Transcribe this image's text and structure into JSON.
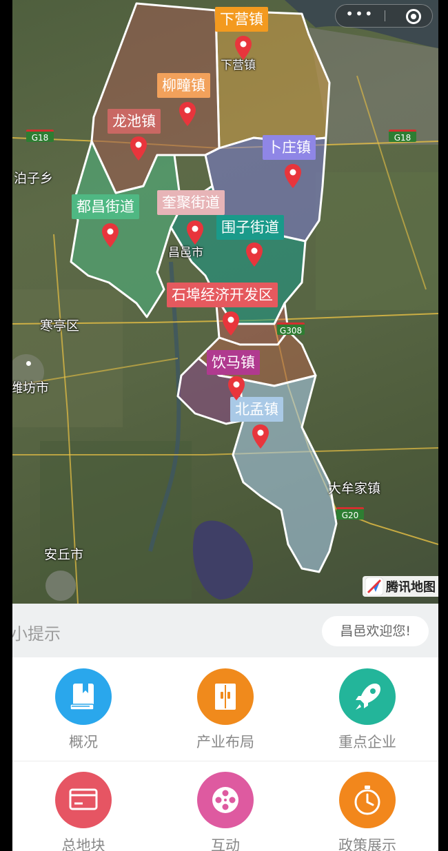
{
  "miniprogram": {
    "more_label": "•••"
  },
  "map": {
    "places": [
      {
        "label": "泊子乡"
      },
      {
        "label": "寒亭区"
      },
      {
        "label": "潍坊市"
      },
      {
        "label": "安丘市"
      },
      {
        "label": "大牟家镇"
      },
      {
        "label": "昌邑市"
      },
      {
        "label": "下营镇"
      }
    ],
    "roads": [
      "G18",
      "G18",
      "G308",
      "G20"
    ],
    "towns": [
      {
        "label": "下营镇",
        "color": "#f39a1f"
      },
      {
        "label": "柳疃镇",
        "color": "#f2a15b"
      },
      {
        "label": "龙池镇",
        "color": "#c96863"
      },
      {
        "label": "卜庄镇",
        "color": "#8f86e6"
      },
      {
        "label": "都昌街道",
        "color": "#4fb883"
      },
      {
        "label": "奎聚街道",
        "color": "#e7b4b7"
      },
      {
        "label": "围子街道",
        "color": "#1a9a8a"
      },
      {
        "label": "石埠经济开发区",
        "color": "#e5595e"
      },
      {
        "label": "饮马镇",
        "color": "#b03a8f"
      },
      {
        "label": "北孟镇",
        "color": "#a9c9e6"
      }
    ],
    "provider": "腾讯地图"
  },
  "tips": {
    "title": "小提示",
    "welcome": "昌邑欢迎您!"
  },
  "menu": [
    {
      "label": "概况",
      "icon": "book-icon",
      "color": "#2aa7ec"
    },
    {
      "label": "产业布局",
      "icon": "door-icon",
      "color": "#f08a1c"
    },
    {
      "label": "重点企业",
      "icon": "rocket-icon",
      "color": "#23b59a"
    },
    {
      "label": "总地块",
      "icon": "card-icon",
      "color": "#e65563"
    },
    {
      "label": "互动",
      "icon": "film-reel-icon",
      "color": "#de5aa0"
    },
    {
      "label": "政策展示",
      "icon": "stopwatch-icon",
      "color": "#f2871c"
    }
  ]
}
